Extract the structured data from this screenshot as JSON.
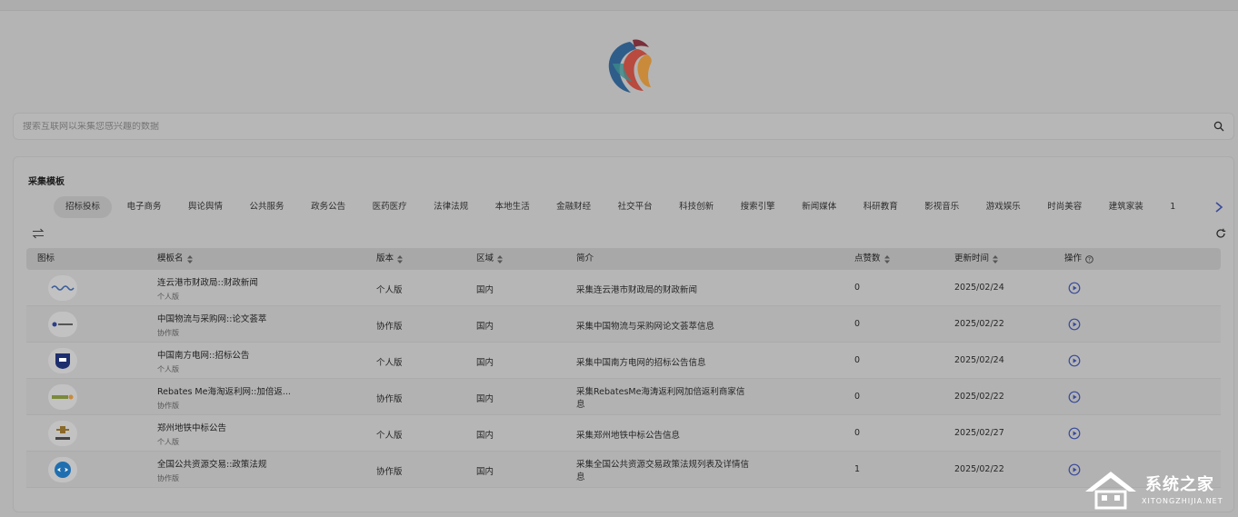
{
  "search": {
    "placeholder": "搜索互联网以采集您感兴趣的数据"
  },
  "panel": {
    "title": "采集模板"
  },
  "tabs": [
    "招标投标",
    "电子商务",
    "舆论舆情",
    "公共服务",
    "政务公告",
    "医药医疗",
    "法律法规",
    "本地生活",
    "金融财经",
    "社交平台",
    "科技创新",
    "搜索引擎",
    "新闻媒体",
    "科研教育",
    "影视音乐",
    "游戏娱乐",
    "时尚美容",
    "建筑家装",
    "1"
  ],
  "table": {
    "headers": {
      "icon": "图标",
      "name": "模板名",
      "version": "版本",
      "region": "区域",
      "desc": "简介",
      "likes": "点赞数",
      "updated": "更新时间",
      "action": "操作"
    },
    "rows": [
      {
        "name": "连云港市财政局::财政新闻",
        "edition": "个人版",
        "version": "个人版",
        "region": "国内",
        "desc": "采集连云港市财政局的财政新闻",
        "desc2": "",
        "likes": "0",
        "updated": "2025/02/24",
        "icon": "wave-logo-icon"
      },
      {
        "name": "中国物流与采购网::论文荟萃",
        "edition": "协作版",
        "version": "协作版",
        "region": "国内",
        "desc": "采集中国物流与采购网论文荟萃信息",
        "desc2": "",
        "likes": "0",
        "updated": "2025/02/22",
        "icon": "chinawuliu-logo-icon"
      },
      {
        "name": "中国南方电网::招标公告",
        "edition": "个人版",
        "version": "个人版",
        "region": "国内",
        "desc": "采集中国南方电网的招标公告信息",
        "desc2": "",
        "likes": "0",
        "updated": "2025/02/24",
        "icon": "shield-logo-icon"
      },
      {
        "name": "Rebates Me海淘返利网::加倍返...",
        "edition": "协作版",
        "version": "协作版",
        "region": "国内",
        "desc": "采集RebatesMe海涛返利网加倍返利商家信",
        "desc2": "息",
        "likes": "0",
        "updated": "2025/02/22",
        "icon": "rebatesme-logo-icon"
      },
      {
        "name": "郑州地铁中标公告",
        "edition": "个人版",
        "version": "个人版",
        "region": "国内",
        "desc": "采集郑州地铁中标公告信息",
        "desc2": "",
        "likes": "0",
        "updated": "2025/02/27",
        "icon": "metro-logo-icon"
      },
      {
        "name": "全国公共资源交易::政策法规",
        "edition": "协作版",
        "version": "协作版",
        "region": "国内",
        "desc": "采集全国公共资源交易政策法规列表及详情信",
        "desc2": "息",
        "likes": "1",
        "updated": "2025/02/22",
        "icon": "globe-logo-icon"
      }
    ]
  },
  "watermark": {
    "title": "系统之家",
    "sub": "XITONGZHIJIA.NET"
  }
}
